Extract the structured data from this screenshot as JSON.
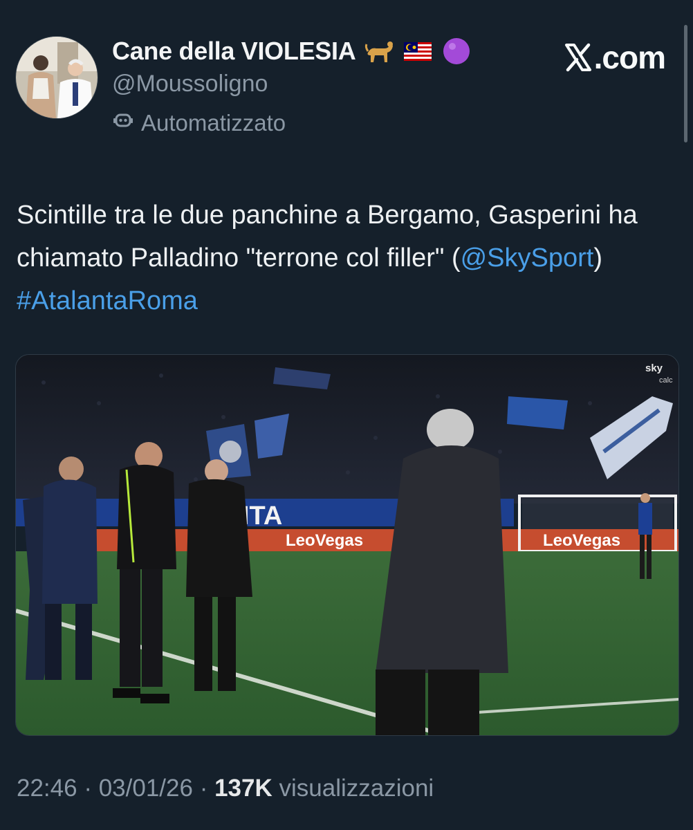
{
  "author": {
    "display_name": "Cane della VIOLESIA",
    "handle": "@Moussoligno",
    "automated_label": "Automatizzato",
    "emojis": [
      "dog-icon",
      "malaysia-flag-icon",
      "purple-circle-icon"
    ]
  },
  "site_logo": ".com",
  "tweet": {
    "text_part1": "Scintille tra le due panchine a Bergamo, Gasperini ha chiamato Palladino \"terrone col filler\" (",
    "mention": "@SkySport",
    "text_part2": ") ",
    "hashtag": "#AtalantaRoma"
  },
  "media": {
    "banner_left": "NTA",
    "sponsor_1": "LeoVegas",
    "sponsor_2": "LeoVegas",
    "broadcaster": "sky",
    "broadcaster_sub": "calc"
  },
  "footer": {
    "time": "22:46",
    "date": "03/01/26",
    "separator": "·",
    "views_count": "137K",
    "views_label": "visualizzazioni"
  },
  "colors": {
    "background": "#15202b",
    "link": "#4a9fe8",
    "muted": "#8b98a5"
  }
}
